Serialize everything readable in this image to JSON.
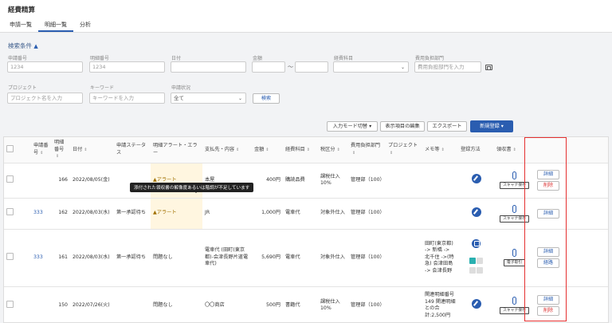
{
  "app": {
    "title": "経費精算"
  },
  "tabs": [
    {
      "label": "申請一覧"
    },
    {
      "label": "明細一覧"
    },
    {
      "label": "分析"
    }
  ],
  "search": {
    "heading": "検索条件",
    "fields": {
      "application_no": {
        "label": "申請番号",
        "placeholder": "1234"
      },
      "detail_no": {
        "label": "明細番号",
        "placeholder": "1234"
      },
      "date": {
        "label": "日付"
      },
      "amount": {
        "label": "金額",
        "range_sep": "〜"
      },
      "expense_item": {
        "label": "経費科目"
      },
      "cost_dept": {
        "label": "費用負担部門",
        "placeholder": "費用負担部門を入力"
      },
      "project": {
        "label": "プロジェクト",
        "placeholder": "プロジェクト名を入力"
      },
      "keyword": {
        "label": "キーワード",
        "placeholder": "キーワードを入力"
      },
      "status": {
        "label": "申請状況",
        "value": "全て"
      }
    },
    "search_button": "検索"
  },
  "toolbar": {
    "input_mode": "入力モード切替",
    "edit_columns": "表示項目の編集",
    "export": "エクスポート",
    "new_entry": "新規登録"
  },
  "table": {
    "headers": {
      "app_no": "申請番号",
      "detail_no": "明細番号",
      "date": "日付",
      "status": "申請ステータス",
      "alert": "明細アラート・エラー",
      "payee": "支払先・内容",
      "amount": "金額",
      "item": "経費科目",
      "tax": "税区分",
      "dept": "費用負担部門",
      "project": "プロジェクト",
      "memo": "メモ等",
      "method": "登録方法",
      "receipt": "領収書"
    },
    "rows": [
      {
        "app_no": "",
        "detail_no": "166",
        "date": "2022/08/05(金)",
        "status": "",
        "alert": "アラート",
        "payee": "本屋",
        "amount": "400円",
        "item": "購読品費",
        "tax": "課税仕入10%",
        "dept": "管理部（100）",
        "project": "",
        "memo": "",
        "receipt_tag": "スキャナ保存",
        "actions": [
          "詳細",
          "削除"
        ]
      },
      {
        "app_no": "333",
        "detail_no": "162",
        "date": "2022/08/03(水)",
        "status": "第一承認待ち",
        "alert": "アラート",
        "payee": "JR",
        "amount": "1,000円",
        "item": "電車代",
        "tax": "対象外仕入",
        "dept": "管理部（100）",
        "project": "",
        "memo": "",
        "receipt_tag": "スキャナ保存",
        "actions": [
          "詳細"
        ]
      },
      {
        "app_no": "333",
        "detail_no": "161",
        "date": "2022/08/03(水)",
        "status": "第一承認待ち",
        "alert": "問題なし",
        "payee": "電車代 (田町(東京都)-会津長野片道電車代)",
        "amount": "5,690円",
        "item": "電車代",
        "tax": "対象外仕入",
        "dept": "管理部（100）",
        "project": "",
        "memo": "田町(東京都) -> 新橋 -> 北千住 ->(特急) 会津田島 -> 会津長野",
        "receipt_tag": "電子取引",
        "actions": [
          "詳細",
          "経路"
        ]
      },
      {
        "app_no": "",
        "detail_no": "150",
        "date": "2022/07/26(火)",
        "status": "",
        "alert": "問題なし",
        "payee": "〇〇商店",
        "amount": "500円",
        "item": "書籍代",
        "tax": "課税仕入10%",
        "dept": "管理部（100）",
        "project": "",
        "memo": "関連明細番号 149 関連明細との合計:2,500円",
        "receipt_tag": "スキャナ保存",
        "actions": [
          "詳細",
          "削除"
        ]
      }
    ],
    "tooltip": "添付された領収書の解像度あるいは階調が不足しています"
  },
  "colors": {
    "accent": "#2a5db0",
    "alert_bg": "#fff6e0",
    "highlight_frame": "#e53030"
  }
}
